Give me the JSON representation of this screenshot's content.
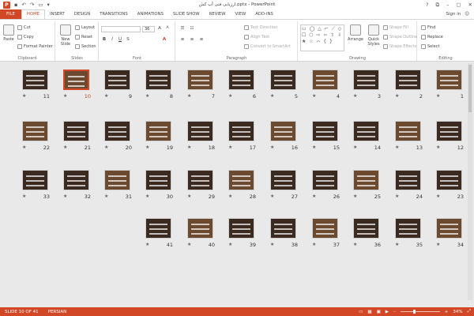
{
  "app": {
    "title": "ارزیابی فنی آب کش.pptx - PowerPoint",
    "icon_label": "P",
    "window_controls": [
      "?",
      "⧉",
      "–",
      "▢",
      "✕"
    ]
  },
  "tabs": [
    {
      "label": "FILE",
      "kind": "file"
    },
    {
      "label": "HOME",
      "kind": "active"
    },
    {
      "label": "INSERT",
      "kind": ""
    },
    {
      "label": "DESIGN",
      "kind": ""
    },
    {
      "label": "TRANSITIONS",
      "kind": ""
    },
    {
      "label": "ANIMATIONS",
      "kind": ""
    },
    {
      "label": "SLIDE SHOW",
      "kind": ""
    },
    {
      "label": "REVIEW",
      "kind": ""
    },
    {
      "label": "VIEW",
      "kind": ""
    },
    {
      "label": "ADD-INS",
      "kind": ""
    }
  ],
  "signin": {
    "label": "Sign in",
    "smiley": "☺"
  },
  "ribbon": {
    "clipboard": {
      "paste": "Paste",
      "cut": "Cut",
      "copy": "Copy",
      "format_painter": "Format Painter",
      "label": "Clipboard"
    },
    "slides": {
      "new_slide": "New Slide",
      "layout": "Layout",
      "reset": "Reset",
      "section": "Section",
      "label": "Slides"
    },
    "font": {
      "size": "36",
      "bold": "B",
      "italic": "I",
      "underline": "U",
      "strike": "S",
      "label": "Font"
    },
    "paragraph": {
      "text_direction": "Text Direction",
      "align_text": "Align Text",
      "convert_smartart": "Convert to SmartArt",
      "label": "Paragraph"
    },
    "drawing": {
      "arrange": "Arrange",
      "quick_styles": "Quick Styles",
      "shape_fill": "Shape Fill",
      "shape_outline": "Shape Outline",
      "shape_effects": "Shape Effects",
      "label": "Drawing",
      "shapes": "▭ ◯ △ ⌐ ⟋ ◇ ☐ ⬡ ⇨ ⇦ ⇧ ⇩ ★ ☆ ⌒ { }"
    },
    "editing": {
      "find": "Find",
      "replace": "Replace",
      "select": "Select",
      "label": "Editing"
    }
  },
  "slides": [
    {
      "num": "1"
    },
    {
      "num": "2"
    },
    {
      "num": "3"
    },
    {
      "num": "4"
    },
    {
      "num": "5"
    },
    {
      "num": "6"
    },
    {
      "num": "7"
    },
    {
      "num": "8"
    },
    {
      "num": "9"
    },
    {
      "num": "10"
    },
    {
      "num": "11"
    },
    {
      "num": "12"
    },
    {
      "num": "13"
    },
    {
      "num": "14"
    },
    {
      "num": "15"
    },
    {
      "num": "16"
    },
    {
      "num": "17"
    },
    {
      "num": "18"
    },
    {
      "num": "19"
    },
    {
      "num": "20"
    },
    {
      "num": "21"
    },
    {
      "num": "22"
    },
    {
      "num": "23"
    },
    {
      "num": "24"
    },
    {
      "num": "25"
    },
    {
      "num": "26"
    },
    {
      "num": "27"
    },
    {
      "num": "28"
    },
    {
      "num": "29"
    },
    {
      "num": "30"
    },
    {
      "num": "31"
    },
    {
      "num": "32"
    },
    {
      "num": "33"
    },
    {
      "num": "34"
    },
    {
      "num": "35"
    },
    {
      "num": "36"
    },
    {
      "num": "37"
    },
    {
      "num": "38"
    },
    {
      "num": "39"
    },
    {
      "num": "40"
    },
    {
      "num": "41"
    }
  ],
  "selected_slide": "10",
  "star_glyph": "★",
  "status": {
    "slide_info": "SLIDE 10 OF 41",
    "language": "PERSIAN",
    "zoom": "34%",
    "zoom_fraction": 0.34,
    "zoom_minus": "–",
    "zoom_plus": "+"
  },
  "colors": {
    "accent": "#d24726",
    "thumb_dark": "#3a2a20",
    "thumb_warm": "#6b4a30"
  }
}
